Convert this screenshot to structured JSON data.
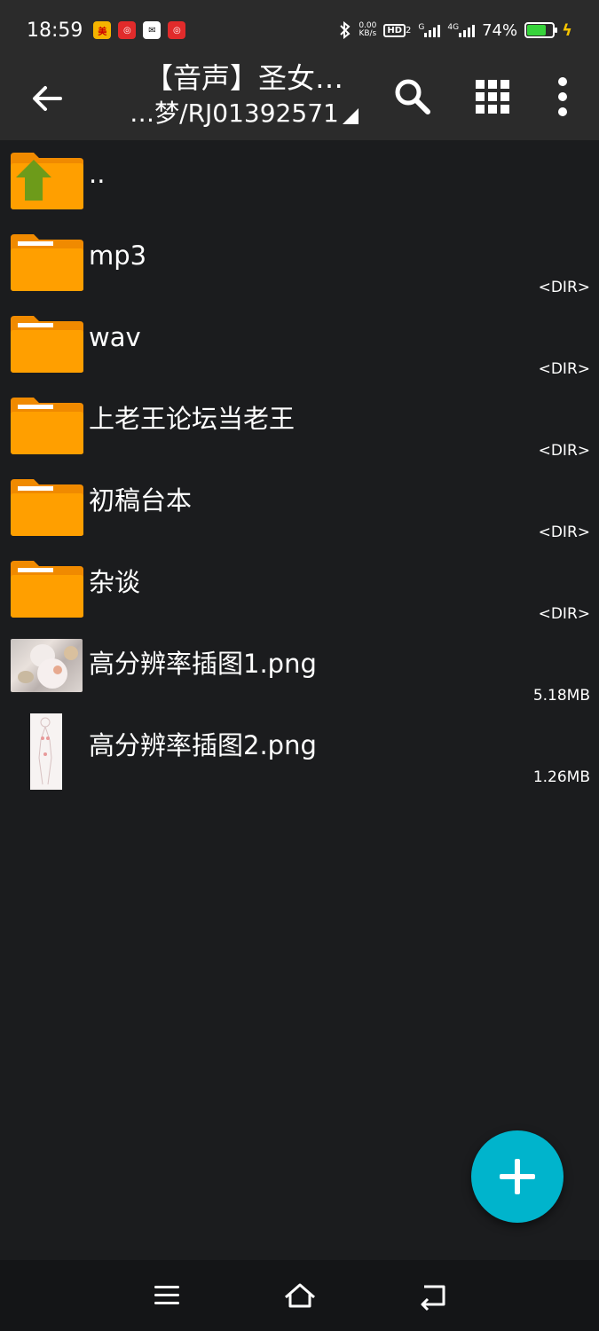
{
  "status_bar": {
    "time": "18:59",
    "speed_top": "0.00",
    "speed_bottom": "KB/s",
    "hd_label": "HD",
    "hd_sub": "2",
    "net_1": "G",
    "net_2": "4G",
    "battery_percent": "74%",
    "battery_level": 0.74,
    "colors": {
      "battery_fill": "#37d33b",
      "bolt": "#f5c400"
    }
  },
  "toolbar": {
    "title": "【音声】圣女…",
    "path": "…梦/RJ01392571",
    "icons": [
      "back-arrow-icon",
      "search-icon",
      "grid-view-icon",
      "more-vert-icon"
    ]
  },
  "files": [
    {
      "name": "..",
      "meta": "",
      "type": "parent"
    },
    {
      "name": "mp3",
      "meta": "<DIR>",
      "type": "folder"
    },
    {
      "name": "wav",
      "meta": "<DIR>",
      "type": "folder"
    },
    {
      "name": "上老王论坛当老王",
      "meta": "<DIR>",
      "type": "folder"
    },
    {
      "name": "初稿台本",
      "meta": "<DIR>",
      "type": "folder"
    },
    {
      "name": "杂谈",
      "meta": "<DIR>",
      "type": "folder"
    },
    {
      "name": "高分辨率插图1.png",
      "meta": "5.18MB",
      "type": "image"
    },
    {
      "name": "高分辨率插图2.png",
      "meta": "1.26MB",
      "type": "image"
    }
  ],
  "fab": {
    "icon": "plus-icon",
    "color": "#00b4cc"
  },
  "nav_bar": {
    "icons": [
      "menu-icon",
      "home-icon",
      "back-icon"
    ]
  },
  "colors": {
    "background": "#1b1c1e",
    "toolbar": "#2b2b2b",
    "folder": "#ff9f00",
    "folder_dark": "#f08a00",
    "parent_arrow": "#6d9b1a"
  }
}
